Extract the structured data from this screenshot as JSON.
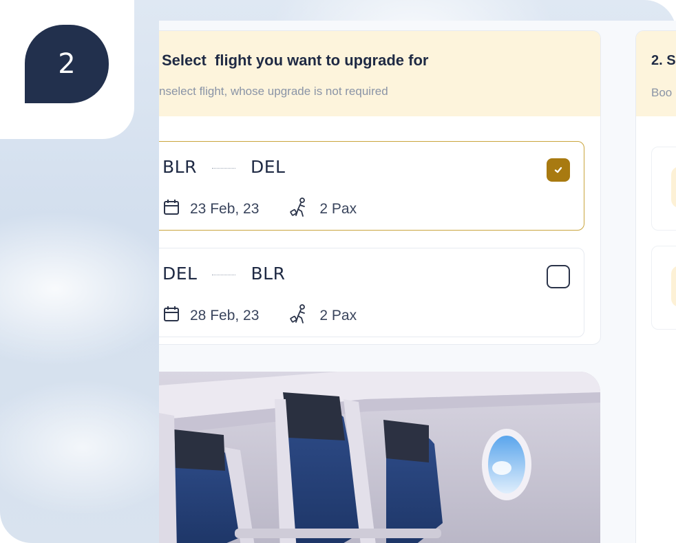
{
  "step": {
    "number": "2"
  },
  "flight_selection": {
    "title": "Select  flight you want to upgrade for",
    "subtitle": "nselect flight, whose upgrade is not required",
    "flights": [
      {
        "from": "BLR",
        "to": "DEL",
        "date": "23 Feb, 23",
        "pax": "2 Pax",
        "selected": true
      },
      {
        "from": "DEL",
        "to": "BLR",
        "date": "28 Feb, 23",
        "pax": "2 Pax",
        "selected": false
      }
    ]
  },
  "next_panel": {
    "title": "2. S",
    "subtitle": "Boo"
  },
  "colors": {
    "accent_gold": "#a87a11",
    "badge_navy": "#22304d",
    "header_cream": "#fdf4dc"
  },
  "icons": [
    "calendar-icon",
    "passenger-icon",
    "checkmark-icon"
  ]
}
